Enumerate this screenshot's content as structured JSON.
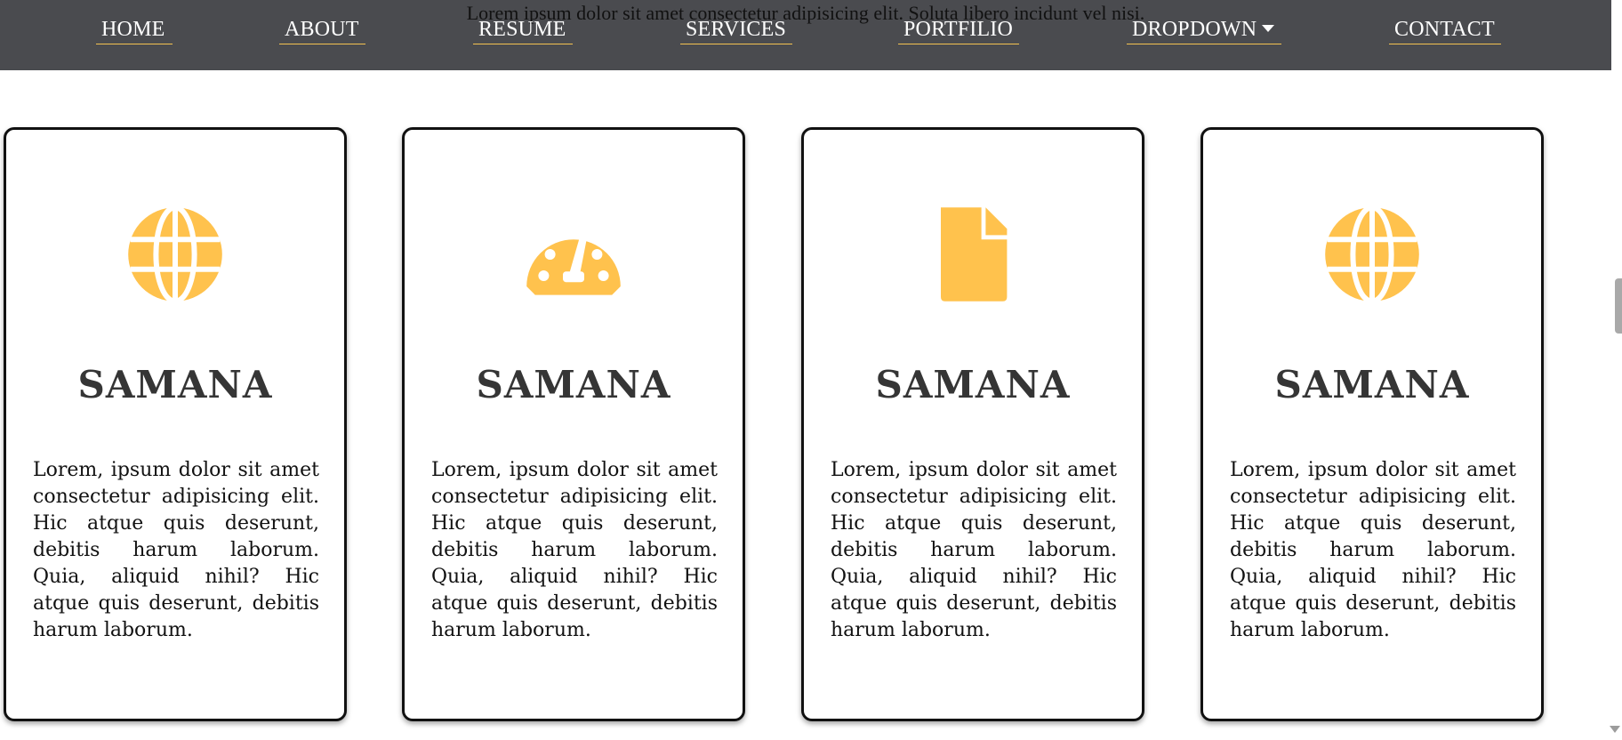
{
  "header": {
    "overlay_text": "Lorem ipsum dolor sit amet consectetur adipisicing elit. Soluta libero incidunt vel nisi.",
    "nav": [
      {
        "label": "HOME"
      },
      {
        "label": "ABOUT"
      },
      {
        "label": "RESUME"
      },
      {
        "label": "SERVICES"
      },
      {
        "label": "PORTFILIO"
      },
      {
        "label": "DROPDOWN"
      },
      {
        "label": "CONTACT"
      }
    ]
  },
  "cards": [
    {
      "icon": "globe-icon",
      "title": "SAMANA",
      "text": "Lorem, ipsum dolor sit amet consectetur adipisicing elit. Hic atque quis deserunt, debitis harum laborum. Quia, aliquid nihil? Hic atque quis deserunt, debitis harum laborum."
    },
    {
      "icon": "gauge-icon",
      "title": "SAMANA",
      "text": "Lorem, ipsum dolor sit amet consectetur adipisicing elit. Hic atque quis deserunt, debitis harum laborum. Quia, aliquid nihil? Hic atque quis deserunt, debitis harum laborum."
    },
    {
      "icon": "file-icon",
      "title": "SAMANA",
      "text": "Lorem, ipsum dolor sit amet consectetur adipisicing elit. Hic atque quis deserunt, debitis harum laborum. Quia, aliquid nihil? Hic atque quis deserunt, debitis harum laborum."
    },
    {
      "icon": "globe-icon",
      "title": "SAMANA",
      "text": "Lorem, ipsum dolor sit amet consectetur adipisicing elit. Hic atque quis deserunt, debitis harum laborum. Quia, aliquid nihil? Hic atque quis deserunt, debitis harum laborum."
    }
  ],
  "colors": {
    "nav_background": "#4a4b4f",
    "accent": "#f3c251",
    "title_text": "#353535"
  }
}
